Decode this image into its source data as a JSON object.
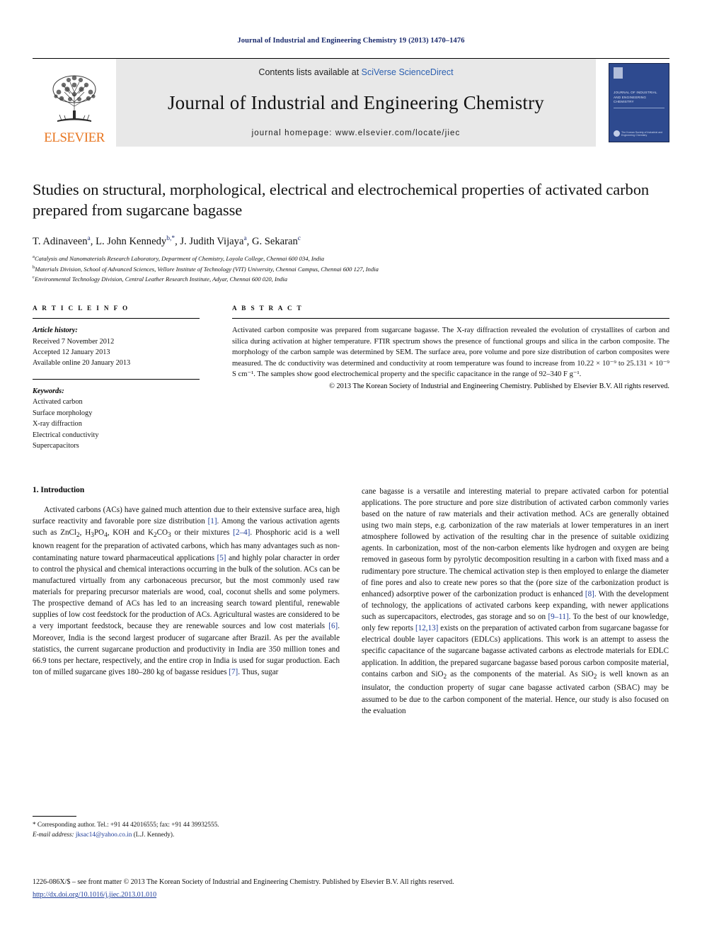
{
  "running_head": "Journal of Industrial and Engineering Chemistry 19 (2013) 1470–1476",
  "masthead": {
    "contents_prefix": "Contents lists available at ",
    "sciencedirect": "SciVerse ScienceDirect",
    "journal_title": "Journal of Industrial and Engineering Chemistry",
    "homepage": "journal homepage: www.elsevier.com/locate/jiec",
    "publisher_wordmark": "ELSEVIER",
    "cover": {
      "title_lines": "JOURNAL OF INDUSTRIAL AND ENGINEERING CHEMISTRY",
      "society": "The Korean Society of Industrial and Engineering Chemistry"
    }
  },
  "article": {
    "title": "Studies on structural, morphological, electrical and electrochemical properties of activated carbon prepared from sugarcane bagasse",
    "authors": [
      {
        "name": "T. Adinaveen",
        "marks": "a"
      },
      {
        "name": "L. John Kennedy",
        "marks": "b,*"
      },
      {
        "name": "J. Judith Vijaya",
        "marks": "a"
      },
      {
        "name": "G. Sekaran",
        "marks": "c"
      }
    ],
    "affiliations": [
      {
        "mark": "a",
        "text": "Catalysis and Nanomaterials Research Laboratory, Department of Chemistry, Loyola College, Chennai 600 034, India"
      },
      {
        "mark": "b",
        "text": "Materials Division, School of Advanced Sciences, Vellore Institute of Technology (VIT) University, Chennai Campus, Chennai 600 127, India"
      },
      {
        "mark": "c",
        "text": "Environmental Technology Division, Central Leather Research Institute, Adyar, Chennai 600 020, India"
      }
    ]
  },
  "article_info": {
    "label": "A R T I C L E   I N F O",
    "history_head": "Article history:",
    "history": [
      "Received 7 November 2012",
      "Accepted 12 January 2013",
      "Available online 20 January 2013"
    ],
    "keywords_head": "Keywords:",
    "keywords": [
      "Activated carbon",
      "Surface morphology",
      "X-ray diffraction",
      "Electrical conductivity",
      "Supercapacitors"
    ]
  },
  "abstract": {
    "label": "A B S T R A C T",
    "body": "Activated carbon composite was prepared from sugarcane bagasse. The X-ray diffraction revealed the evolution of crystallites of carbon and silica during activation at higher temperature. FTIR spectrum shows the presence of functional groups and silica in the carbon composite. The morphology of the carbon sample was determined by SEM. The surface area, pore volume and pore size distribution of carbon composites were measured. The dc conductivity was determined and conductivity at room temperature was found to increase from 10.22 × 10⁻⁹ to 25.131 × 10⁻⁹ S cm⁻¹. The samples show good electrochemical property and the specific capacitance in the range of 92–340 F g⁻¹.",
    "copyright": "© 2013 The Korean Society of Industrial and Engineering Chemistry. Published by Elsevier B.V. All rights reserved."
  },
  "introduction": {
    "heading": "1. Introduction",
    "left_paragraph": "Activated carbons (ACs) have gained much attention due to their extensive surface area, high surface reactivity and favorable pore size distribution [1]. Among the various activation agents such as ZnCl2, H3PO4, KOH and K2CO3 or their mixtures [2–4]. Phosphoric acid is a well known reagent for the preparation of activated carbons, which has many advantages such as non-contaminating nature toward pharmaceutical applications [5] and highly polar character in order to control the physical and chemical interactions occurring in the bulk of the solution. ACs can be manufactured virtually from any carbonaceous precursor, but the most commonly used raw materials for preparing precursor materials are wood, coal, coconut shells and some polymers. The prospective demand of ACs has led to an increasing search toward plentiful, renewable supplies of low cost feedstock for the production of ACs. Agricultural wastes are considered to be a very important feedstock, because they are renewable sources and low cost materials [6]. Moreover, India is the second largest producer of sugarcane after Brazil. As per the available statistics, the current sugarcane production and productivity in India are 350 million tones and 66.9 tons per hectare, respectively, and the entire crop in India is used for sugar production. Each ton of milled sugarcane gives 180–280 kg of bagasse residues [7]. Thus, sugar",
    "right_paragraph": "cane bagasse is a versatile and interesting material to prepare activated carbon for potential applications. The pore structure and pore size distribution of activated carbon commonly varies based on the nature of raw materials and their activation method. ACs are generally obtained using two main steps, e.g. carbonization of the raw materials at lower temperatures in an inert atmosphere followed by activation of the resulting char in the presence of suitable oxidizing agents. In carbonization, most of the non-carbon elements like hydrogen and oxygen are being removed in gaseous form by pyrolytic decomposition resulting in a carbon with fixed mass and a rudimentary pore structure. The chemical activation step is then employed to enlarge the diameter of fine pores and also to create new pores so that the (pore size of the carbonization product is enhanced) adsorptive power of the carbonization product is enhanced [8]. With the development of technology, the applications of activated carbons keep expanding, with newer applications such as supercapacitors, electrodes, gas storage and so on [9–11]. To the best of our knowledge, only few reports [12,13] exists on the preparation of activated carbon from sugarcane bagasse for electrical double layer capacitors (EDLCs) applications. This work is an attempt to assess the specific capacitance of the sugarcane bagasse activated carbons as electrode materials for EDLC application. In addition, the prepared sugarcane bagasse based porous carbon composite material, contains carbon and SiO2 as the components of the material. As SiO2 is well known as an insulator, the conduction property of sugar cane bagasse activated carbon (SBAC) may be assumed to be due to the carbon component of the material. Hence, our study is also focused on the evaluation"
  },
  "footnote": {
    "corresponding": "* Corresponding author. Tel.: +91 44 42016555; fax: +91 44 39932555.",
    "email_label": "E-mail address:",
    "email": "jksac14@yahoo.co.in",
    "email_suffix": "(L.J. Kennedy)."
  },
  "footer": {
    "issn_line": "1226-086X/$ – see front matter © 2013 The Korean Society of Industrial and Engineering Chemistry. Published by Elsevier B.V. All rights reserved.",
    "doi": "http://dx.doi.org/10.1016/j.jiec.2013.01.010"
  }
}
